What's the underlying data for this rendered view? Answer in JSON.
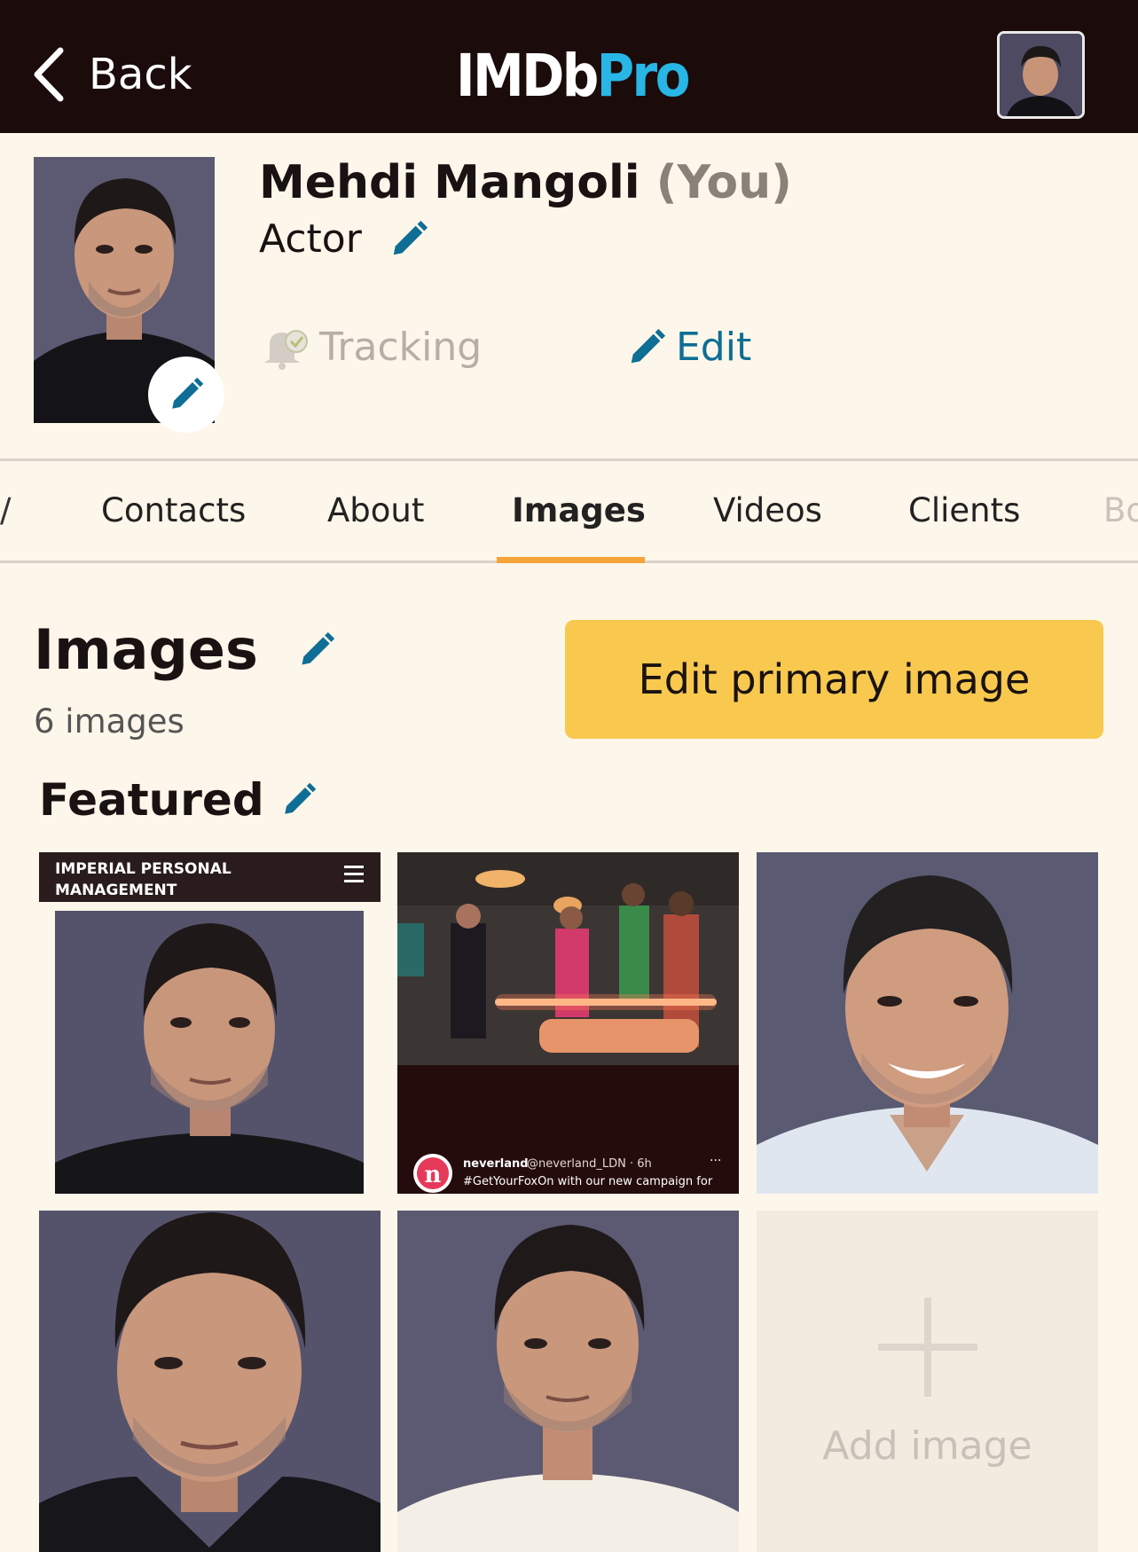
{
  "header": {
    "back_label": "Back",
    "logo_imdb": "IMDb",
    "logo_pro": "Pro"
  },
  "profile": {
    "name": "Mehdi Mangoli",
    "you_tag": "(You)",
    "role": "Actor",
    "tracking_label": "Tracking",
    "edit_label": "Edit"
  },
  "tabs": [
    {
      "label": "Contacts"
    },
    {
      "label": "About"
    },
    {
      "label": "Images"
    },
    {
      "label": "Videos"
    },
    {
      "label": "Clients"
    },
    {
      "label": "Bo"
    }
  ],
  "images_section": {
    "title": "Images",
    "count_label": "6 images",
    "edit_primary_label": "Edit primary image",
    "featured_label": "Featured",
    "add_image_label": "Add image"
  },
  "tile1": {
    "banner_line1": "IMPERIAL PERSONAL",
    "banner_line2": "MANAGEMENT"
  },
  "tile2": {
    "account": "neverland",
    "handle": "@neverland_LDN · 6h",
    "caption": "#GetYourFoxOn with our new campaign for"
  },
  "colors": {
    "header_bg": "#1b0b0b",
    "accent_blue": "#0e6e95",
    "button_yellow": "#f8c94e",
    "tab_underline": "#f5a43a",
    "page_bg": "#fdf6ea"
  }
}
